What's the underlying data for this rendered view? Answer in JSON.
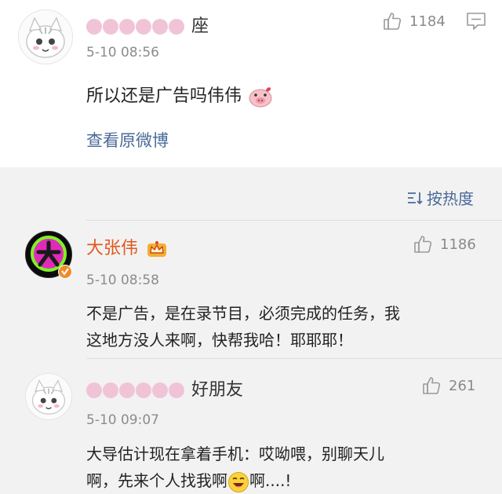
{
  "main_comment": {
    "username": "座",
    "timestamp": "5-10 08:56",
    "likes": "1184",
    "text": "所以还是广告吗伟伟",
    "view_original_label": "查看原微博"
  },
  "sort": {
    "label": "按热度"
  },
  "replies": [
    {
      "username": "大张伟",
      "timestamp": "5-10 08:58",
      "likes": "1186",
      "text_line1": "不是广告，是在录节目，必须完成的任务，我",
      "text_line2": "这地方没人来啊，快帮我哈！耶耶耶！"
    },
    {
      "username": "好朋友",
      "timestamp": "5-10 09:07",
      "likes": "261",
      "text_line1": "大导估计现在拿着手机：哎呦喂，别聊天儿",
      "text_line2_a": "啊，先来个人找我啊",
      "text_line2_b": "啊....!"
    }
  ],
  "colors": {
    "link": "#4a6a9a",
    "username_verified": "#e0581f",
    "muted": "#8c8c8c"
  },
  "icons": [
    "thumbs-up-icon",
    "comment-icon",
    "sort-icon",
    "crown-badge-icon",
    "verified-badge-icon",
    "pig-emoji",
    "laughing-emoji"
  ]
}
